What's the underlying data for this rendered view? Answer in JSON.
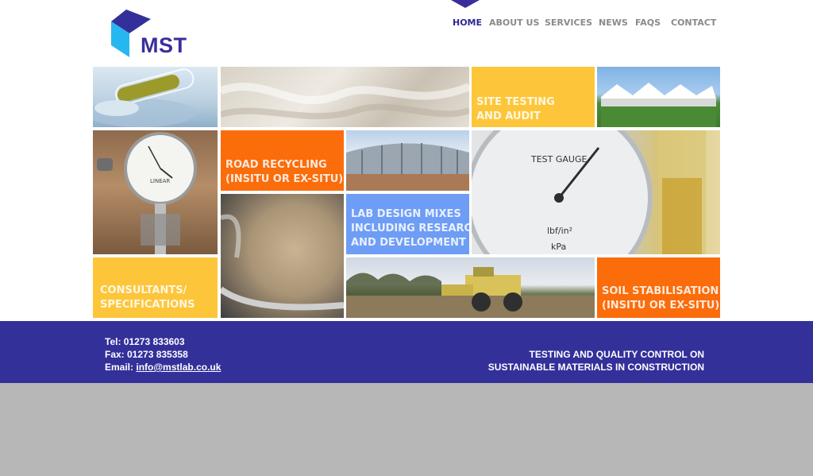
{
  "brand": {
    "name": "MST",
    "colors": {
      "primary": "#34309a",
      "cyan": "#27b7f0",
      "yellow": "#fdc63a",
      "orange": "#fb6c0b",
      "blue": "#6e9df6"
    }
  },
  "nav": {
    "items": [
      {
        "label": "HOME",
        "active": true
      },
      {
        "label": "ABOUT US",
        "active": false
      },
      {
        "label": "SERVICES",
        "active": false
      },
      {
        "label": "NEWS",
        "active": false
      },
      {
        "label": "FAQS",
        "active": false
      },
      {
        "label": "CONTACT",
        "active": false
      }
    ]
  },
  "tiles": {
    "site_testing": "SITE TESTING\nAND AUDIT",
    "road_recycling": "ROAD RECYCLING\n(INSITU OR EX-SITU)",
    "lab_design": "LAB DESIGN MIXES\nINCLUDING RESEARCH\nAND DEVELOPMENT",
    "consultants": "CONSULTANTS/\nSPECIFICATIONS",
    "soil_stabilisation": "SOIL STABILISATION\n(INSITU OR EX-SITU)"
  },
  "photo_text": {
    "gauge_word": "LINEAR",
    "test_gauge_title": "TEST GAUGE",
    "test_gauge_unit1": "lbf/in²",
    "test_gauge_unit2": "kPa"
  },
  "footer": {
    "tel": "Tel: 01273 833603",
    "fax": "Fax: 01273 835358",
    "email_label": "Email:",
    "email": "info@mstlab.co.uk",
    "tagline_1": "TESTING AND QUALITY CONTROL ON",
    "tagline_2": "SUSTAINABLE MATERIALS IN CONSTRUCTION"
  }
}
